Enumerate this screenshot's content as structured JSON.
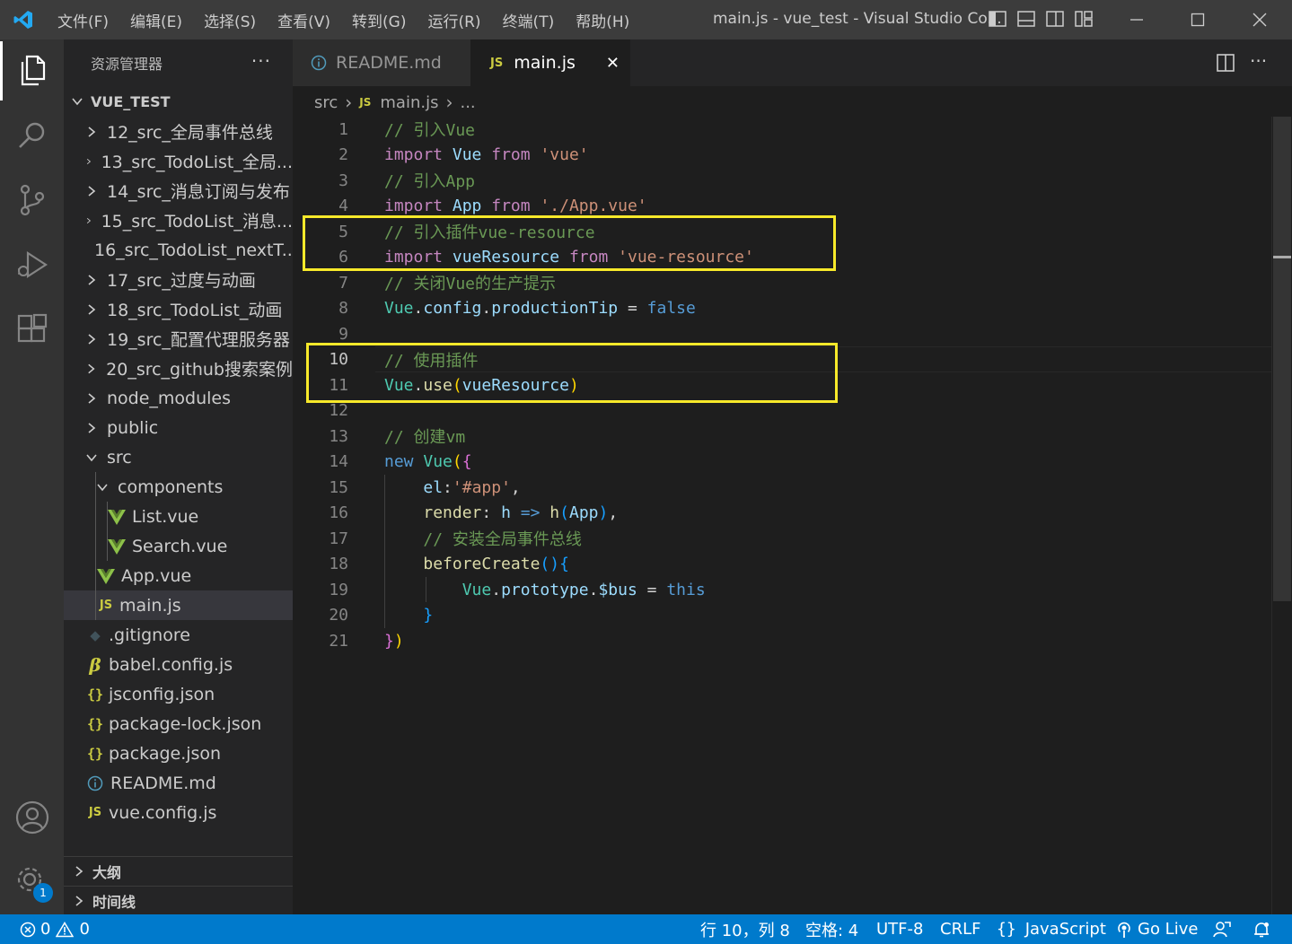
{
  "menu": [
    "文件(F)",
    "编辑(E)",
    "选择(S)",
    "查看(V)",
    "转到(G)",
    "运行(R)",
    "终端(T)",
    "帮助(H)"
  ],
  "window_title": "main.js - vue_test - Visual Studio Co...",
  "sidebar": {
    "title": "资源管理器",
    "more": "···",
    "project": "VUE_TEST",
    "items": [
      {
        "label": "12_src_全局事件总线",
        "type": "folder"
      },
      {
        "label": "13_src_TodoList_全局...",
        "type": "folder"
      },
      {
        "label": "14_src_消息订阅与发布",
        "type": "folder"
      },
      {
        "label": "15_src_TodoList_消息...",
        "type": "folder"
      },
      {
        "label": "16_src_TodoList_nextT...",
        "type": "folder"
      },
      {
        "label": "17_src_过度与动画",
        "type": "folder"
      },
      {
        "label": "18_src_TodoList_动画",
        "type": "folder"
      },
      {
        "label": "19_src_配置代理服务器",
        "type": "folder"
      },
      {
        "label": "20_src_github搜索案例",
        "type": "folder"
      },
      {
        "label": "node_modules",
        "type": "folder"
      },
      {
        "label": "public",
        "type": "folder"
      },
      {
        "label": "src",
        "type": "folder-open"
      },
      {
        "label": "components",
        "type": "folder-open"
      },
      {
        "label": "List.vue",
        "type": "vue"
      },
      {
        "label": "Search.vue",
        "type": "vue"
      },
      {
        "label": "App.vue",
        "type": "vue"
      },
      {
        "label": "main.js",
        "type": "js"
      },
      {
        "label": ".gitignore",
        "type": "git"
      },
      {
        "label": "babel.config.js",
        "type": "babel"
      },
      {
        "label": "jsconfig.json",
        "type": "json"
      },
      {
        "label": "package-lock.json",
        "type": "json"
      },
      {
        "label": "package.json",
        "type": "json"
      },
      {
        "label": "README.md",
        "type": "info"
      },
      {
        "label": "vue.config.js",
        "type": "js"
      }
    ],
    "outline": "大纲",
    "timeline": "时间线"
  },
  "tabs": [
    {
      "label": "README.md",
      "icon": "info-icon"
    },
    {
      "label": "main.js",
      "icon": "js-icon",
      "close": "✕"
    }
  ],
  "breadcrumb": {
    "folder": "src",
    "file": "main.js",
    "sep": "›",
    "more": "..."
  },
  "js_badge": "JS",
  "code_lines": [
    [
      [
        "c-com",
        "// 引入Vue"
      ]
    ],
    [
      [
        "c-kw",
        "import"
      ],
      [
        "c-op",
        " "
      ],
      [
        "c-var",
        "Vue"
      ],
      [
        "c-op",
        " "
      ],
      [
        "c-kw",
        "from"
      ],
      [
        "c-op",
        " "
      ],
      [
        "c-str",
        "'vue'"
      ]
    ],
    [
      [
        "c-com",
        "// 引入App"
      ]
    ],
    [
      [
        "c-kw",
        "import"
      ],
      [
        "c-op",
        " "
      ],
      [
        "c-var",
        "App"
      ],
      [
        "c-op",
        " "
      ],
      [
        "c-kw",
        "from"
      ],
      [
        "c-op",
        " "
      ],
      [
        "c-str",
        "'./App.vue'"
      ]
    ],
    [
      [
        "c-com",
        "// 引入插件vue-resource"
      ]
    ],
    [
      [
        "c-kw",
        "import"
      ],
      [
        "c-op",
        " "
      ],
      [
        "c-var",
        "vueResource"
      ],
      [
        "c-op",
        " "
      ],
      [
        "c-kw",
        "from"
      ],
      [
        "c-op",
        " "
      ],
      [
        "c-str",
        "'vue-resource'"
      ]
    ],
    [
      [
        "c-com",
        "// 关闭Vue的生产提示"
      ]
    ],
    [
      [
        "c-cls",
        "Vue"
      ],
      [
        "c-op",
        "."
      ],
      [
        "c-var",
        "config"
      ],
      [
        "c-op",
        "."
      ],
      [
        "c-var",
        "productionTip"
      ],
      [
        "c-op",
        " = "
      ],
      [
        "c-bool",
        "false"
      ]
    ],
    [],
    [
      [
        "c-com",
        "// 使用插件"
      ]
    ],
    [
      [
        "c-cls",
        "Vue"
      ],
      [
        "c-op",
        "."
      ],
      [
        "c-fn",
        "use"
      ],
      [
        "c-b1",
        "("
      ],
      [
        "c-var",
        "vueResource"
      ],
      [
        "c-b1",
        ")"
      ]
    ],
    [],
    [
      [
        "c-com",
        "// 创建vm"
      ]
    ],
    [
      [
        "c-bool",
        "new"
      ],
      [
        "c-op",
        " "
      ],
      [
        "c-cls",
        "Vue"
      ],
      [
        "c-b1",
        "("
      ],
      [
        "c-b2",
        "{"
      ]
    ],
    [
      [
        "c-op",
        "    "
      ],
      [
        "c-var",
        "el"
      ],
      [
        "c-op",
        ":"
      ],
      [
        "c-str",
        "'#app'"
      ],
      [
        "c-op",
        ","
      ]
    ],
    [
      [
        "c-op",
        "    "
      ],
      [
        "c-fn",
        "render"
      ],
      [
        "c-op",
        ": "
      ],
      [
        "c-var",
        "h"
      ],
      [
        "c-op",
        " "
      ],
      [
        "c-bool",
        "=>"
      ],
      [
        "c-op",
        " "
      ],
      [
        "c-fn",
        "h"
      ],
      [
        "c-b3",
        "("
      ],
      [
        "c-var",
        "App"
      ],
      [
        "c-b3",
        ")"
      ],
      [
        "c-op",
        ","
      ]
    ],
    [
      [
        "c-op",
        "    "
      ],
      [
        "c-com",
        "// 安装全局事件总线"
      ]
    ],
    [
      [
        "c-op",
        "    "
      ],
      [
        "c-fn",
        "beforeCreate"
      ],
      [
        "c-b3",
        "()"
      ],
      [
        "c-b3",
        "{"
      ]
    ],
    [
      [
        "c-op",
        "        "
      ],
      [
        "c-cls",
        "Vue"
      ],
      [
        "c-op",
        "."
      ],
      [
        "c-var",
        "prototype"
      ],
      [
        "c-op",
        "."
      ],
      [
        "c-var",
        "$bus"
      ],
      [
        "c-op",
        " = "
      ],
      [
        "c-bool",
        "this"
      ]
    ],
    [
      [
        "c-op",
        "    "
      ],
      [
        "c-b3",
        "}"
      ]
    ],
    [
      [
        "c-b2",
        "}"
      ],
      [
        "c-b1",
        ")"
      ]
    ]
  ],
  "current_line": 10,
  "status": {
    "errors": "0",
    "warnings": "0",
    "position": "行 10，列 8",
    "spaces": "空格: 4",
    "encoding": "UTF-8",
    "eol": "CRLF",
    "language": "JavaScript",
    "golive": "Go Live",
    "settings_badge": "1"
  }
}
